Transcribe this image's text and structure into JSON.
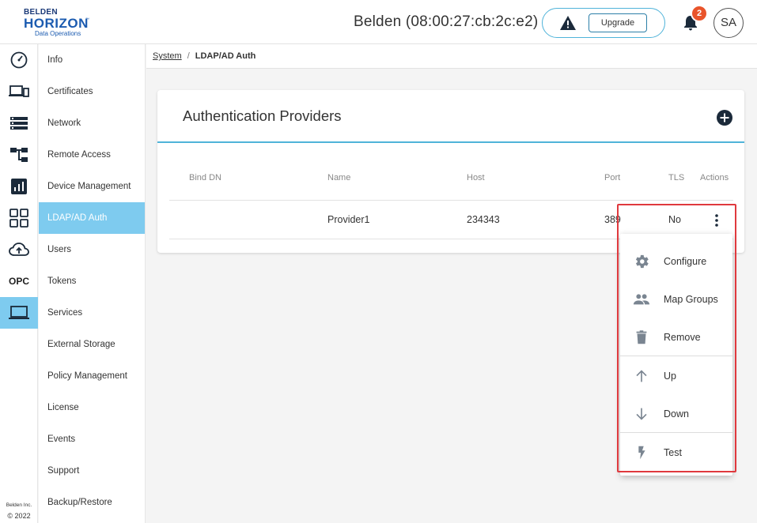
{
  "header": {
    "logo_line1": "BELDEN",
    "logo_line2": "HORIZON",
    "logo_tm": "™",
    "logo_line3": "Data Operations",
    "device_title": "Belden (08:00:27:cb:2c:e2)",
    "upgrade_label": "Upgrade",
    "notification_count": "2",
    "avatar_initials": "SA",
    "warning_color": "#1b2a3a",
    "badge_color": "#e9542b"
  },
  "rail": {
    "icons": [
      "dashboard-icon",
      "devices-icon",
      "list-icon",
      "topology-icon",
      "reports-icon",
      "apps-icon",
      "cloud-upload-icon",
      "opc-label",
      "laptop-icon"
    ],
    "opc_label": "OPC",
    "footer_company": "Belden Inc.",
    "footer_copyright": "© 2022"
  },
  "sidebar": {
    "items": [
      {
        "label": "Info"
      },
      {
        "label": "Certificates"
      },
      {
        "label": "Network"
      },
      {
        "label": "Remote Access"
      },
      {
        "label": "Device Management"
      },
      {
        "label": "LDAP/AD Auth"
      },
      {
        "label": "Users"
      },
      {
        "label": "Tokens"
      },
      {
        "label": "Services"
      },
      {
        "label": "External Storage"
      },
      {
        "label": "Policy Management"
      },
      {
        "label": "License"
      },
      {
        "label": "Events"
      },
      {
        "label": "Support"
      },
      {
        "label": "Backup/Restore"
      }
    ],
    "active_color": "#7ecbef"
  },
  "breadcrumb": {
    "parent": "System",
    "separator": "/",
    "current": "LDAP/AD Auth"
  },
  "card": {
    "title": "Authentication Providers",
    "accent_color": "#4fb3d9",
    "columns": [
      "Bind DN",
      "Name",
      "Host",
      "Port",
      "TLS",
      "Actions"
    ],
    "rows": [
      {
        "bind_dn": "",
        "name": "Provider1",
        "host": "234343",
        "port": "389",
        "tls": "No"
      }
    ]
  },
  "action_menu": {
    "items": [
      {
        "label": "Configure",
        "icon": "gear-icon"
      },
      {
        "label": "Map Groups",
        "icon": "group-icon"
      },
      {
        "label": "Remove",
        "icon": "trash-icon"
      },
      {
        "label": "Up",
        "icon": "arrow-up-icon"
      },
      {
        "label": "Down",
        "icon": "arrow-down-icon"
      },
      {
        "label": "Test",
        "icon": "bolt-icon"
      }
    ],
    "highlight_color": "#e0393e"
  }
}
